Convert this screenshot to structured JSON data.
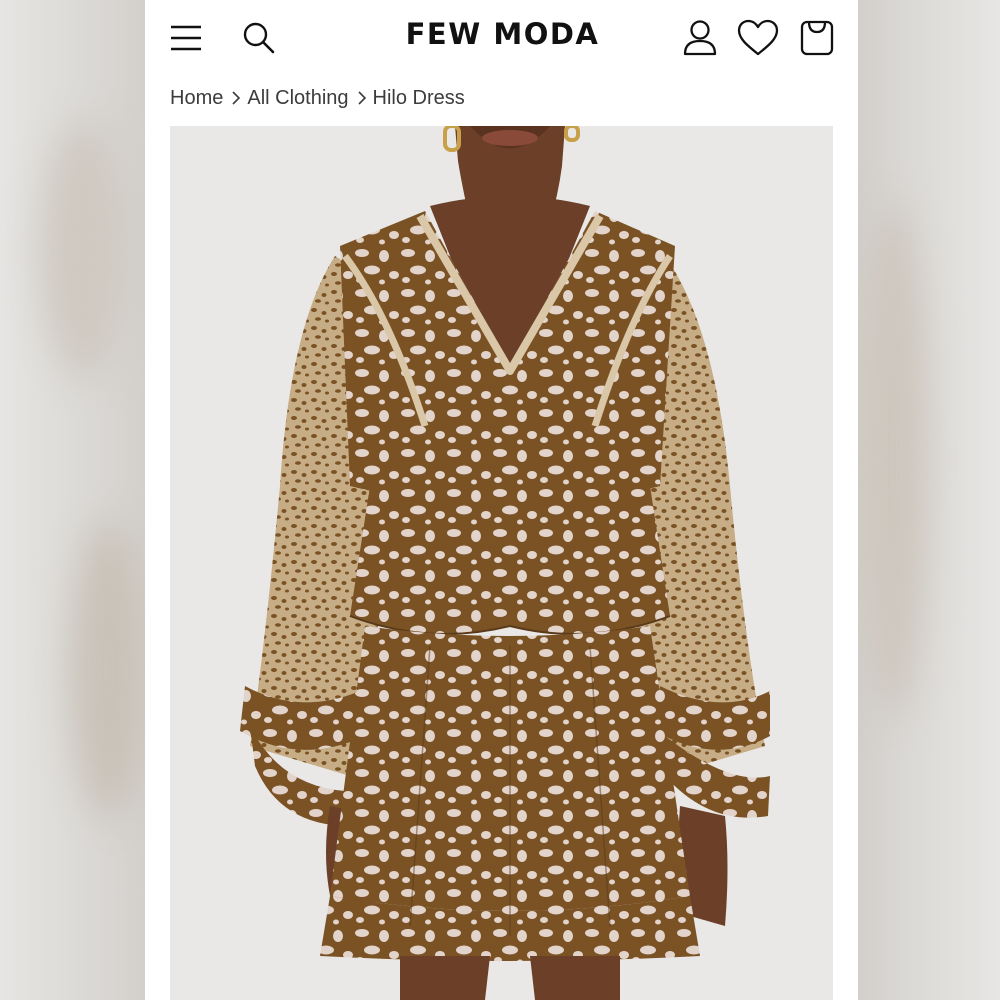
{
  "header": {
    "logo_text": "FEW MODA",
    "icons": [
      "menu-icon",
      "search-icon",
      "account-icon",
      "heart-icon",
      "bag-icon"
    ]
  },
  "breadcrumb": {
    "items": [
      "Home",
      "All Clothing",
      "Hilo Dress"
    ]
  },
  "product_image": {
    "alt": "Hilo Dress",
    "fabric_base_color": "#7a5224",
    "fabric_spot_color": "#e2d3cb",
    "skin_color": "#6b3f28"
  },
  "colors": {
    "background": "#ffffff",
    "text": "#111111",
    "breadcrumb_text": "#3c3c3c"
  }
}
